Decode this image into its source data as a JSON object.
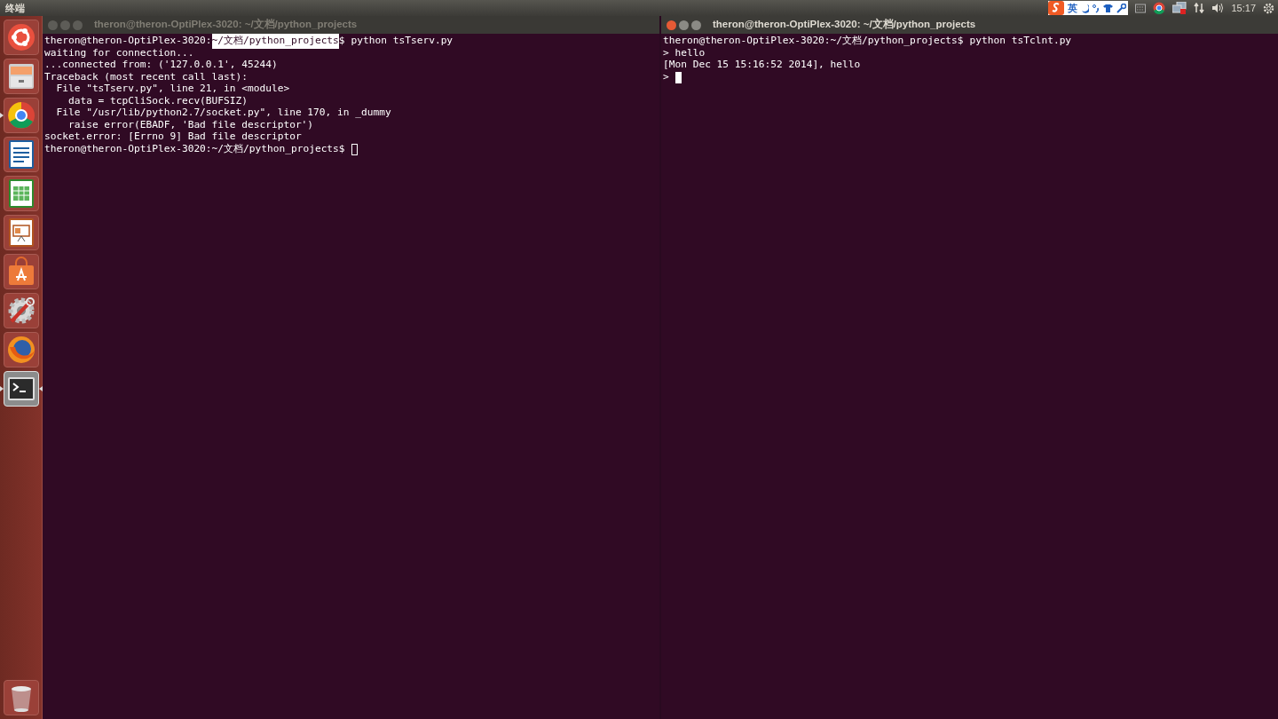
{
  "top_bar": {
    "app_title": "终端",
    "input_method": "英",
    "clock": "15:17"
  },
  "launcher": [
    {
      "kind": "dash",
      "running": false,
      "focused": false
    },
    {
      "kind": "files",
      "running": false,
      "focused": false
    },
    {
      "kind": "chrome",
      "running": true,
      "focused": false
    },
    {
      "kind": "writer",
      "running": false,
      "focused": false
    },
    {
      "kind": "calc",
      "running": false,
      "focused": false
    },
    {
      "kind": "impress",
      "running": false,
      "focused": false
    },
    {
      "kind": "store",
      "running": false,
      "focused": false
    },
    {
      "kind": "settings",
      "running": false,
      "focused": false
    },
    {
      "kind": "firefox",
      "running": false,
      "focused": false
    },
    {
      "kind": "terminal",
      "running": true,
      "focused": true
    },
    {
      "kind": "trash",
      "running": false,
      "focused": false
    }
  ],
  "terminals": [
    {
      "title": "theron@theron-OptiPlex-3020: ~/文档/python_projects",
      "active": false,
      "lines": [
        {
          "kind": "prompt",
          "host": "theron@theron-OptiPlex-3020:",
          "path": "~/文档/python_projects",
          "path_selected": true,
          "symbol": "$",
          "command": "python tsTserv.py"
        },
        {
          "kind": "output",
          "text": "waiting for connection..."
        },
        {
          "kind": "output",
          "text": "...connected from: ('127.0.0.1', 45244)"
        },
        {
          "kind": "output",
          "text": "Traceback (most recent call last):"
        },
        {
          "kind": "output",
          "text": "  File \"tsTserv.py\", line 21, in <module>"
        },
        {
          "kind": "output",
          "text": "    data = tcpCliSock.recv(BUFSIZ)"
        },
        {
          "kind": "output",
          "text": "  File \"/usr/lib/python2.7/socket.py\", line 170, in _dummy"
        },
        {
          "kind": "output",
          "text": "    raise error(EBADF, 'Bad file descriptor')"
        },
        {
          "kind": "output",
          "text": "socket.error: [Errno 9] Bad file descriptor"
        },
        {
          "kind": "prompt",
          "host": "theron@theron-OptiPlex-3020:",
          "path": "~/文档/python_projects",
          "path_selected": false,
          "symbol": "$"
        }
      ]
    },
    {
      "title": "theron@theron-OptiPlex-3020: ~/文档/python_projects",
      "active": true,
      "lines": [
        {
          "kind": "prompt",
          "host": "theron@theron-OptiPlex-3020:",
          "path": "~/文档/python_projects",
          "path_selected": false,
          "symbol": "$",
          "command": "python tsTclnt.py"
        },
        {
          "kind": "output",
          "text": "> hello"
        },
        {
          "kind": "output",
          "text": "[Mon Dec 15 15:16:52 2014], hello"
        },
        {
          "kind": "output",
          "text": ">"
        }
      ]
    }
  ]
}
